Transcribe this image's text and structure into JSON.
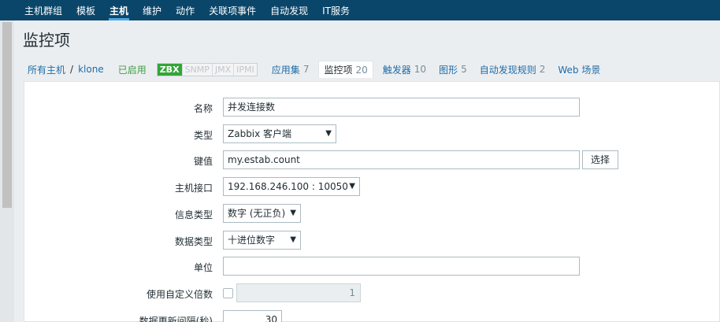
{
  "topnav": {
    "items": [
      {
        "label": "主机群组"
      },
      {
        "label": "模板"
      },
      {
        "label": "主机",
        "active": true
      },
      {
        "label": "维护"
      },
      {
        "label": "动作"
      },
      {
        "label": "关联项事件"
      },
      {
        "label": "自动发现"
      },
      {
        "label": "IT服务"
      }
    ]
  },
  "page": {
    "title": "监控项"
  },
  "tabs": {
    "breadcrumb_all_hosts": "所有主机",
    "separator": "/",
    "host_name": "klone",
    "status": "已启用",
    "badges": [
      "ZBX",
      "SNMP",
      "JMX",
      "IPMI"
    ],
    "applications": {
      "label": "应用集",
      "count": "7"
    },
    "items": {
      "label": "监控项",
      "count": "20"
    },
    "triggers": {
      "label": "触发器",
      "count": "10"
    },
    "graphs": {
      "label": "图形",
      "count": "5"
    },
    "discovery": {
      "label": "自动发现规则",
      "count": "2"
    },
    "web": {
      "label": "Web 场景"
    }
  },
  "form": {
    "name": {
      "label": "名称",
      "value": "并发连接数"
    },
    "type": {
      "label": "类型",
      "value": "Zabbix 客户端"
    },
    "key": {
      "label": "键值",
      "value": "my.estab.count",
      "button": "选择"
    },
    "interface": {
      "label": "主机接口",
      "value": "192.168.246.100 : 10050"
    },
    "info_type": {
      "label": "信息类型",
      "value": "数字 (无正负)"
    },
    "data_type": {
      "label": "数据类型",
      "value": "十进位数字"
    },
    "units": {
      "label": "单位",
      "value": ""
    },
    "multiplier": {
      "label": "使用自定义倍数",
      "checked": false,
      "value": "1"
    },
    "interval": {
      "label": "数据更新间隔(秒)",
      "value": "30"
    }
  },
  "colors": {
    "nav_bg": "#0a466a",
    "link": "#1f6ca8",
    "enabled": "#429e47",
    "zbx_badge": "#33a537"
  }
}
